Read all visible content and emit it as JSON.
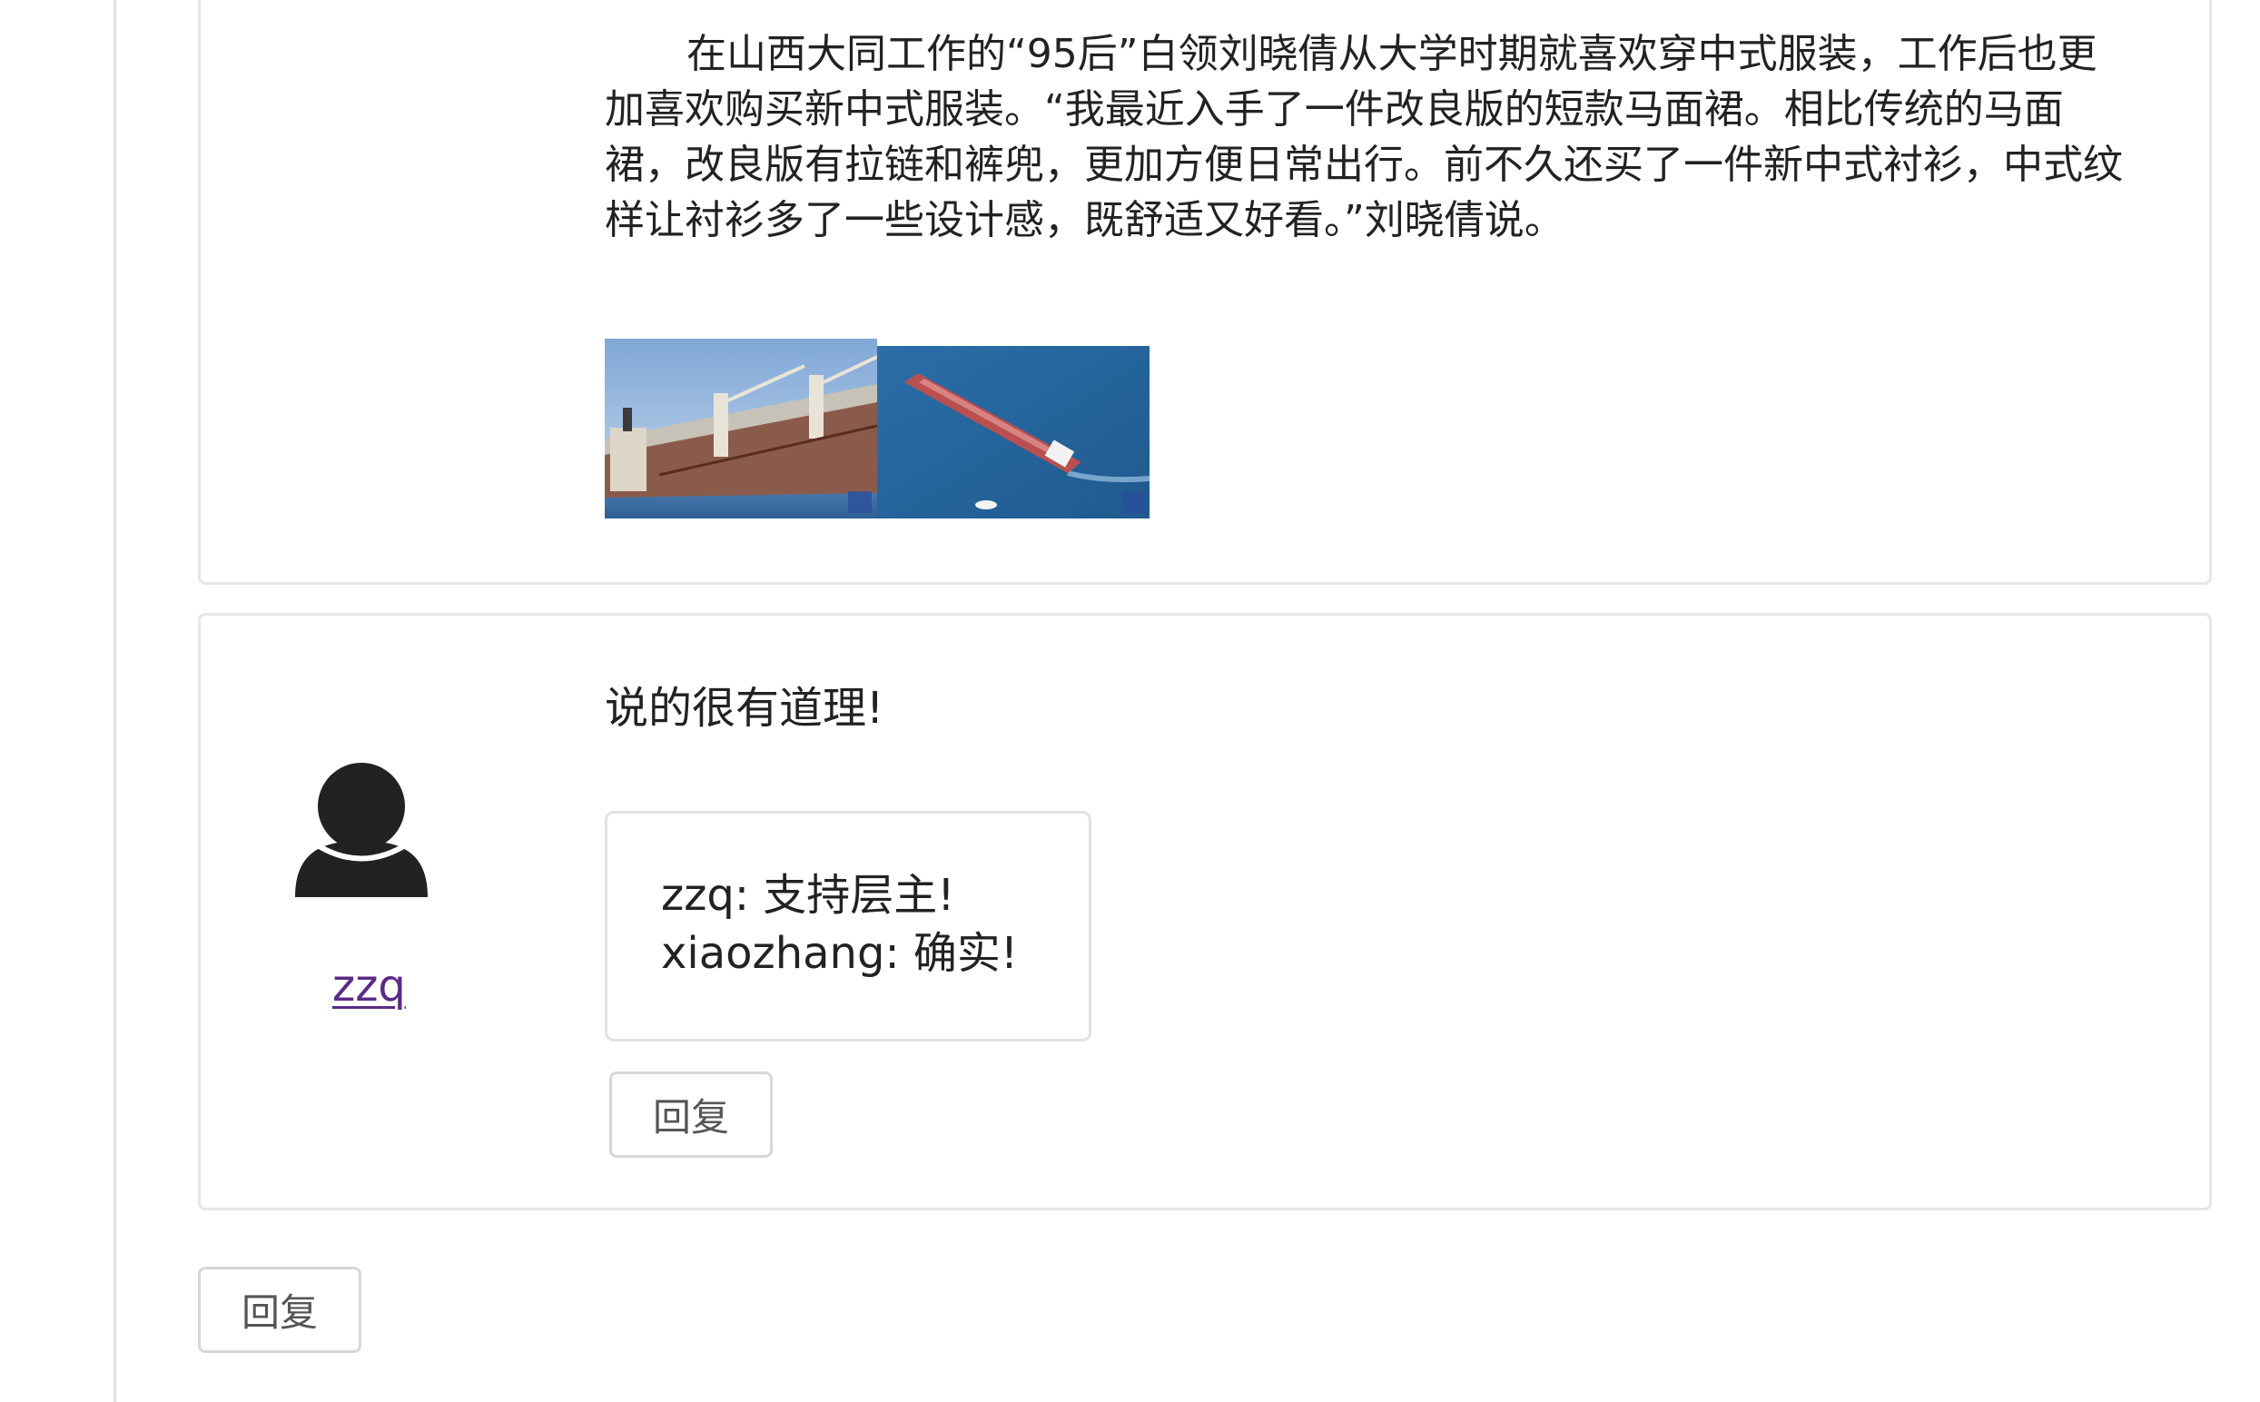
{
  "post": {
    "clipped_heading": "",
    "paragraph": "在山西大同工作的“95后”白领刘晓倩从大学时期就喜欢穿中式服装，工作后也更加喜欢购买新中式服装。“我最近入手了一件改良版的短款马面裙。相比传统的马面裙，改良版有拉链和裤兜，更加方便日常出行。前不久还买了一件新中式衬衫，中式纹样让衬衫多了一些设计感，既舒适又好看。”刘晓倩说。",
    "photos": [
      "ship-photo",
      "ship-aerial-photo"
    ]
  },
  "reply": {
    "username": "zzq",
    "avatar_icon": "user-avatar-icon",
    "text": "说的很有道理!",
    "subcomments": [
      {
        "author": "zzq",
        "sep": ": ",
        "text": "支持层主!"
      },
      {
        "author": "xiaozhang",
        "sep": ": ",
        "text": "确实!"
      }
    ],
    "reply_button_label": "回复"
  },
  "bottom": {
    "reply_button_label": "回复"
  },
  "colors": {
    "link": "#5b2a86",
    "border": "#e6e6e6",
    "text": "#222222"
  }
}
